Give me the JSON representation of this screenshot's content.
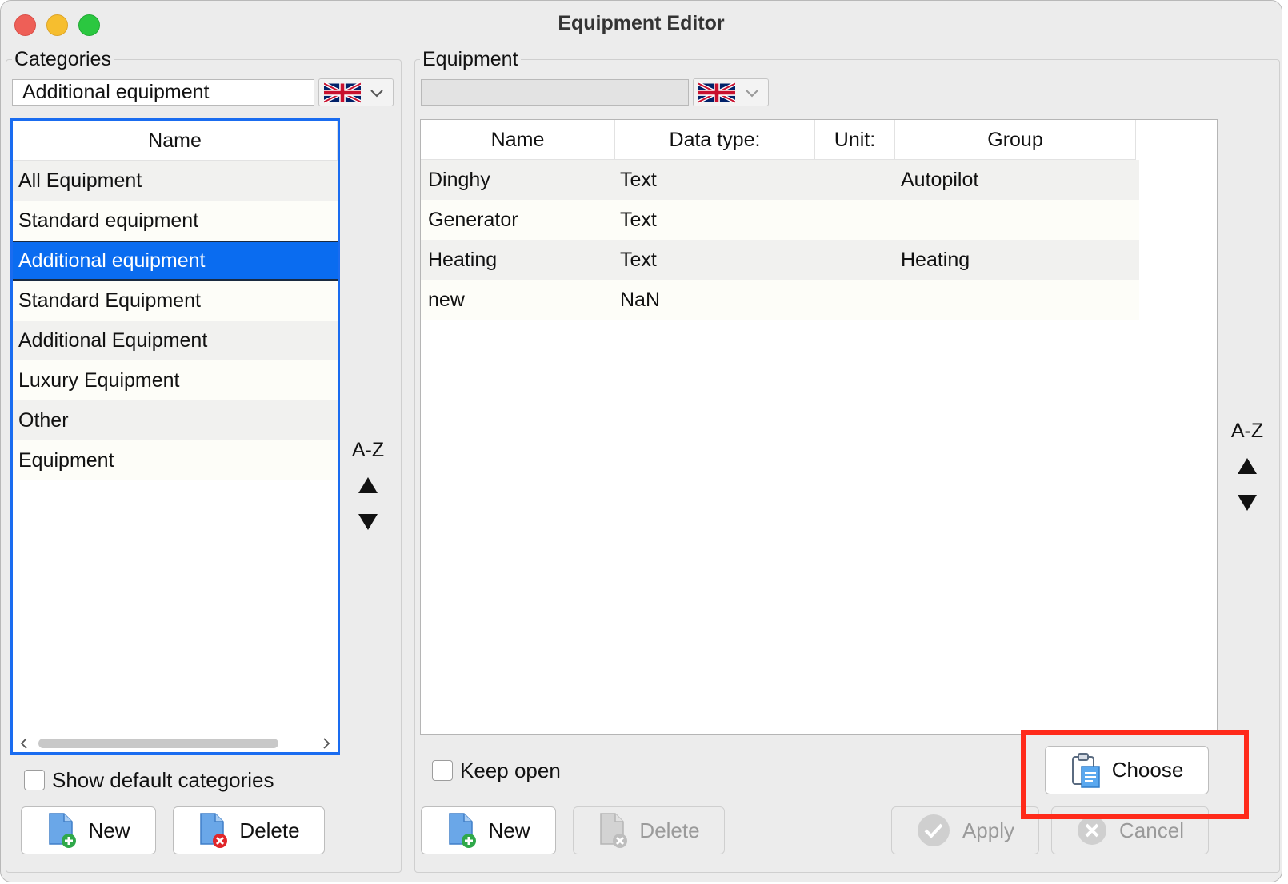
{
  "window": {
    "title": "Equipment Editor"
  },
  "categories": {
    "legend": "Categories",
    "combo_value": "Additional equipment",
    "list_header": "Name",
    "items": [
      "All Equipment",
      "Standard equipment",
      "Additional equipment",
      "Standard Equipment",
      "Additional Equipment",
      "Luxury Equipment",
      "Other",
      "Equipment"
    ],
    "selected_index": 2,
    "sort_label": "A-Z",
    "show_default_label": "Show default categories",
    "new_label": "New",
    "delete_label": "Delete"
  },
  "equipment": {
    "legend": "Equipment",
    "combo_value": "",
    "columns": [
      "Name",
      "Data type:",
      "Unit:",
      "Group"
    ],
    "rows": [
      {
        "name": "Dinghy",
        "type": "Text",
        "unit": "",
        "group": "Autopilot"
      },
      {
        "name": "Generator",
        "type": "Text",
        "unit": "",
        "group": ""
      },
      {
        "name": "Heating",
        "type": "Text",
        "unit": "",
        "group": "Heating"
      },
      {
        "name": "new",
        "type": "NaN",
        "unit": "",
        "group": ""
      }
    ],
    "sort_label": "A-Z",
    "keep_open_label": "Keep open",
    "choose_label": "Choose",
    "new_label": "New",
    "delete_label": "Delete",
    "apply_label": "Apply",
    "cancel_label": "Cancel"
  },
  "colors": {
    "selection": "#0a6cf0",
    "highlight": "#ff2a1a",
    "focus_border": "#1a6cf0"
  }
}
